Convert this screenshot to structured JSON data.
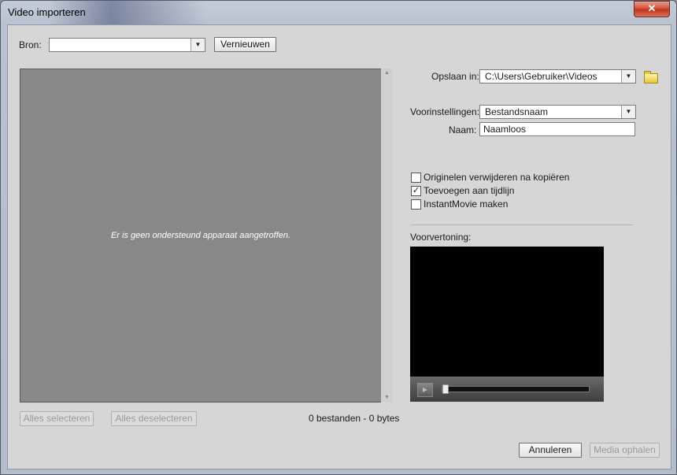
{
  "window": {
    "title": "Video importeren",
    "close_symbol": "✕"
  },
  "source": {
    "label": "Bron:",
    "value": "",
    "refresh_label": "Vernieuwen"
  },
  "list": {
    "empty_message": "Er is geen ondersteund apparaat aangetroffen.",
    "select_all_label": "Alles selecteren",
    "deselect_all_label": "Alles deselecteren",
    "status": "0 bestanden - 0 bytes"
  },
  "save": {
    "label": "Opslaan in:",
    "path": "C:\\Users\\Gebruiker\\Videos"
  },
  "presets": {
    "label": "Voorinstellingen:",
    "value": "Bestandsnaam"
  },
  "name": {
    "label": "Naam:",
    "value": "Naamloos"
  },
  "options": [
    {
      "label": "Originelen verwijderen na kopiëren",
      "checked": false
    },
    {
      "label": "Toevoegen aan tijdlijn",
      "checked": true
    },
    {
      "label": "InstantMovie maken",
      "checked": false
    }
  ],
  "preview": {
    "label": "Voorvertoning:",
    "position": 0
  },
  "footer": {
    "cancel_label": "Annuleren",
    "get_media_label": "Media ophalen"
  },
  "icons": {
    "folder": "folder-icon",
    "play": "play-icon",
    "dropdown": "chevron-down-icon"
  }
}
